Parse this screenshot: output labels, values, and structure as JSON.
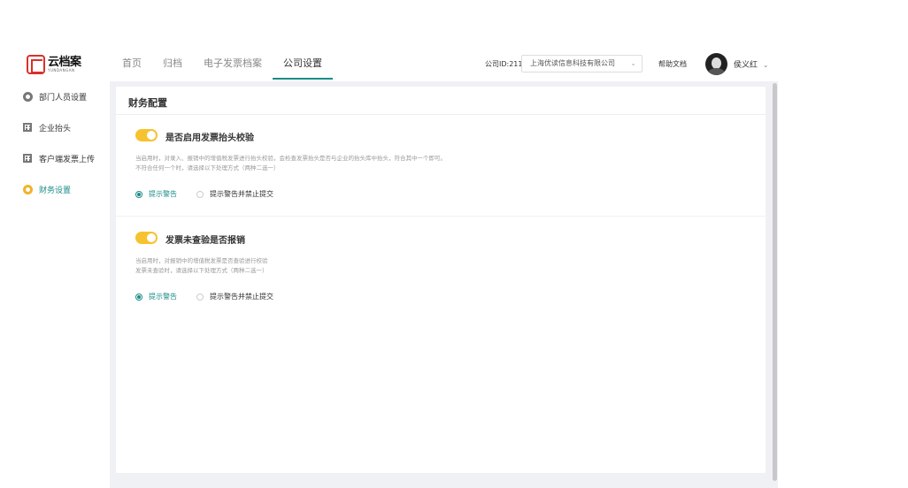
{
  "header": {
    "logo_text": "云档案",
    "logo_sub": "YUNDANGAN",
    "nav": [
      {
        "label": "首页"
      },
      {
        "label": "归档"
      },
      {
        "label": "电子发票档案"
      },
      {
        "label": "公司设置",
        "active": true
      }
    ],
    "company_label": "公司ID:211",
    "company_value": "上海优读信息科技有限公司",
    "help_label": "帮助文档",
    "username": "侯义红"
  },
  "sidebar": {
    "items": [
      {
        "label": "部门人员设置",
        "icon": "gear-icon"
      },
      {
        "label": "企业抬头",
        "icon": "building-icon"
      },
      {
        "label": "客户端发票上传",
        "icon": "building-icon"
      },
      {
        "label": "财务设置",
        "icon": "gear-icon",
        "active": true
      }
    ]
  },
  "main": {
    "title": "财务配置",
    "sections": [
      {
        "title": "是否启用发票抬头校验",
        "enabled": true,
        "desc_line1": "当启用时，对录入、报销中的增值税发票进行抬头校验，会检查发票抬头是否与企业的抬头库中抬头，符合其中一个即可。",
        "desc_line2": "不符合任何一个时，请选择以下处理方式（两种二选一）",
        "option_a": "提示警告",
        "option_b": "提示警告并禁止提交",
        "selected": "a"
      },
      {
        "title": "发票未查验是否报销",
        "enabled": true,
        "desc_line1": "当启用时，对报销中的增值税发票是否查验进行校验",
        "desc_line2": "发票未查验时，请选择以下处理方式（两种二选一）",
        "option_a": "提示警告",
        "option_b": "提示警告并禁止提交",
        "selected": "a"
      }
    ]
  },
  "colors": {
    "accent": "#1a8c87",
    "toggle": "#f7c22f",
    "logo": "#d9302c"
  }
}
